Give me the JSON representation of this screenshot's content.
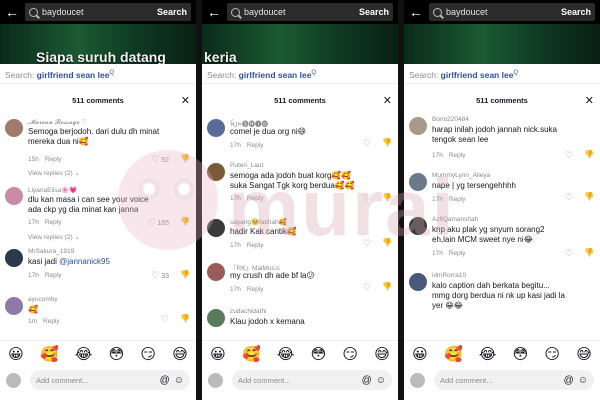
{
  "search": {
    "query": "baydoucet",
    "button": "Search"
  },
  "overlay_texts": [
    "Siapa suruh datang",
    "keria"
  ],
  "suggestion": {
    "prefix": "Search:",
    "query": "girlfriend sean lee"
  },
  "comments_header": "511 comments",
  "watermark": "murai",
  "emojis": [
    "😀",
    "🥰",
    "😂",
    "😳",
    "😏",
    "😅"
  ],
  "add_comment_placeholder": "Add comment...",
  "panels": [
    {
      "comments": [
        {
          "user": "𝓜𝓪𝓻𝓮𝓪𝓷 𝓡𝓮𝓼𝓼𝓪𝓰𝓮 ♡",
          "text": "Semoga berjodoh. dari dulu dh minat mereka dua ni🥰",
          "time": "15h",
          "reply": "Reply",
          "likes": "92",
          "view_replies": "View replies (2)",
          "avatar_color": "#a07a6a"
        },
        {
          "user": "LiyanaElisa🌸💗",
          "text": "dlu kan masa i can see your voice ada ckp yg dia minat kan janna",
          "time": "17h",
          "reply": "Reply",
          "likes": "165",
          "view_replies": "View replies (2)",
          "avatar_color": "#c98aa6"
        },
        {
          "user": "MrSakura_1919",
          "text": "kasi jadi ",
          "mention": "@jannanick95",
          "time": "17h",
          "reply": "Reply",
          "likes": "33",
          "avatar_color": "#2a3a4a"
        },
        {
          "user": "ayucomby",
          "text": "🥰",
          "time": "1m",
          "reply": "Reply",
          "likes": "",
          "avatar_color": "#8d7aa8"
        }
      ]
    },
    {
      "comments": [
        {
          "user": "ꫝ꠸ꪀ🅢🅗🅘🅓",
          "text": "comel je dua org ni😄",
          "time": "17h",
          "reply": "Reply",
          "likes": "",
          "avatar_color": "#5a6a9a"
        },
        {
          "user": "Puteri_Laut",
          "text": "semoga ada jodoh buat korg🥰🥰 suka Sangat Tgk korg berdua🥰🥰",
          "time": "17h",
          "reply": "Reply",
          "likes": "",
          "avatar_color": "#7a5a3a"
        },
        {
          "user": "sayang🥺fatihah🥰",
          "text": "hadir Kak cantik🥰",
          "time": "17h",
          "reply": "Reply",
          "likes": "",
          "avatar_color": "#3a3a3a"
        },
        {
          "user": "『RK』MaiMus⚔",
          "text": "my crush dh ade bf la😕",
          "time": "17h",
          "reply": "Reply",
          "likes": "",
          "avatar_color": "#9a5a5a"
        },
        {
          "user": "zudachidathi",
          "text": "Klau jodoh x kemana",
          "time": "",
          "reply": "",
          "likes": "",
          "avatar_color": "#5a7a5a"
        }
      ]
    },
    {
      "comments": [
        {
          "user": "Bono220484",
          "text": "harap inilah jodoh jannah nick.suka tengok sean lee",
          "time": "17h",
          "reply": "Reply",
          "likes": "",
          "avatar_color": "#a89a8a"
        },
        {
          "user": "MummyLynn_Alieya",
          "text": "nape | yg tersengehhhh",
          "time": "17h",
          "reply": "Reply",
          "likes": "",
          "avatar_color": "#6a7a8a"
        },
        {
          "user": "AzfiQamanshah",
          "text": "knp aku plak yg snyum sorang2 eh,lain MCM sweet nye ni😂",
          "time": "17h",
          "reply": "Reply",
          "likes": "",
          "avatar_color": "#3a3a3a"
        },
        {
          "user": "idmRorra10",
          "text": "kalo caption dah berkata begitu... mmg dorg berdua ni nk up kasi jadi la yer 😁😂",
          "time": "",
          "reply": "",
          "likes": "",
          "avatar_color": "#4a5a7a"
        }
      ]
    }
  ]
}
